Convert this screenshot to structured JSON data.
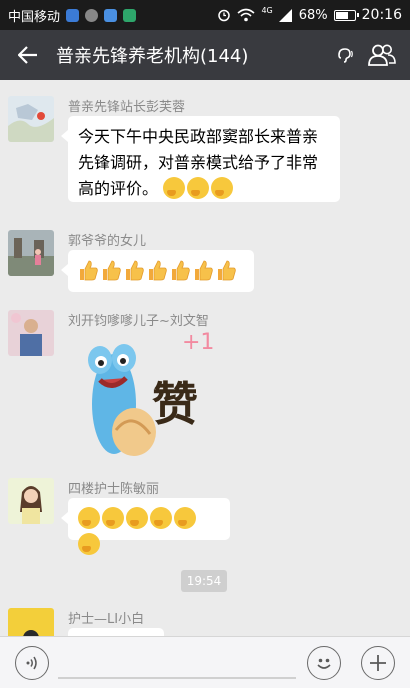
{
  "status_bar": {
    "carrier": "中国移动",
    "network": "4G",
    "battery": "68%",
    "battery_level": 0.68,
    "time": "20:16"
  },
  "header": {
    "title": "普亲先锋养老机构(144)",
    "back_icon": "back-arrow-icon",
    "earpiece_icon": "earpiece-mode-icon",
    "group_icon": "group-members-icon"
  },
  "messages": [
    {
      "sender": "普亲先锋站长彭芙蓉",
      "text": "今天下午中央民政部窦部长来普亲先锋调研，对普亲模式给予了非常高的评价。",
      "emoji_count": 3
    },
    {
      "sender": "郭爷爷的女儿",
      "thumbs_count": 7
    },
    {
      "sender": "刘开钧嗲嗲儿子~刘文智",
      "sticker_text": "赞",
      "sticker_plus": "+1"
    },
    {
      "sender": "四楼护士陈敏丽",
      "emoji_count": 6
    },
    {
      "sender": "护士—LI小白"
    }
  ],
  "timestamp": "19:54",
  "bottom_bar": {
    "voice_icon": "voice-input-icon",
    "emoji_icon": "emoji-icon",
    "plus_icon": "more-plus-icon"
  },
  "colors": {
    "header_bg": "#393a3f",
    "status_bg": "#1b1b1b",
    "chat_bg": "#ebebeb",
    "bubble_bg": "#ffffff"
  }
}
